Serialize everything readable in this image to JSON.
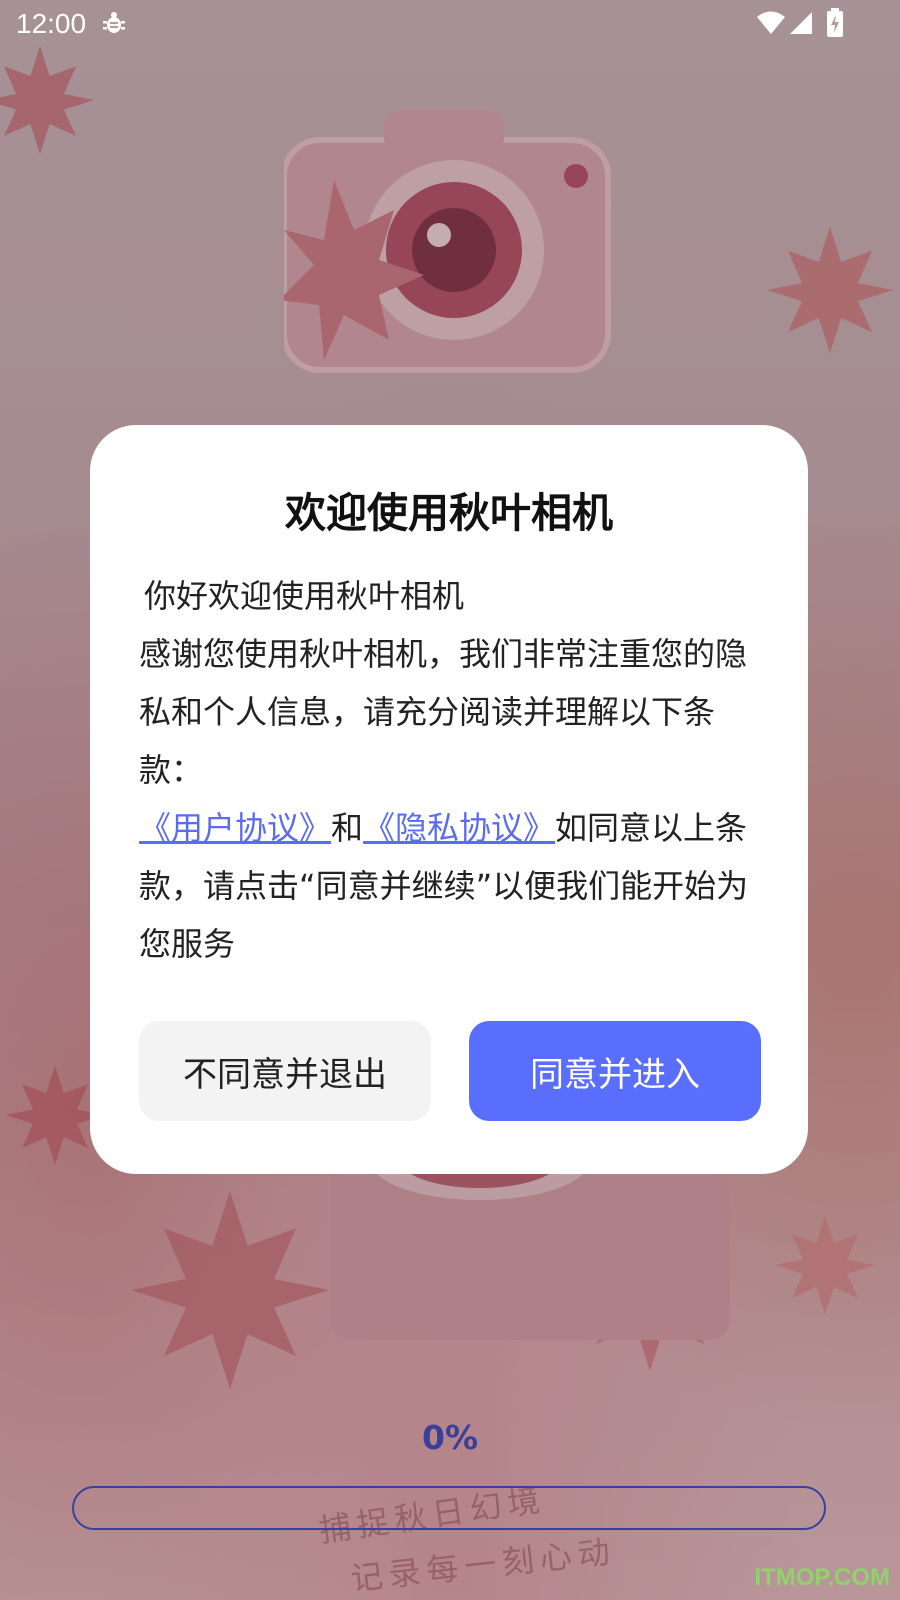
{
  "status_bar": {
    "time": "12:00",
    "icons": [
      "debug-icon",
      "wifi-icon",
      "signal-icon",
      "battery-charging-icon"
    ]
  },
  "background": {
    "slogan_line1": "捕捉秋日幻境",
    "slogan_line2": "记录每一刻心动"
  },
  "dialog": {
    "title": "欢迎使用秋叶相机",
    "greeting": "你好欢迎使用秋叶相机",
    "intro": "感谢您使用秋叶相机，我们非常注重您的隐私和个人信息，请充分阅读并理解以下条款：",
    "user_agreement_link": "《用户协议》",
    "conjunction": "和",
    "privacy_policy_link": "《隐私协议》",
    "outro": "如同意以上条款，请点击“同意并继续”以便我们能开始为您服务",
    "decline_button": "不同意并退出",
    "accept_button": "同意并进入"
  },
  "progress": {
    "label": "0%",
    "value": 0
  },
  "watermark": "ITMOP.COM",
  "colors": {
    "accent": "#5a6efd",
    "link": "#5a6cf0",
    "progress_text": "#3b3f9a",
    "decline_bg": "#f3f3f3"
  }
}
